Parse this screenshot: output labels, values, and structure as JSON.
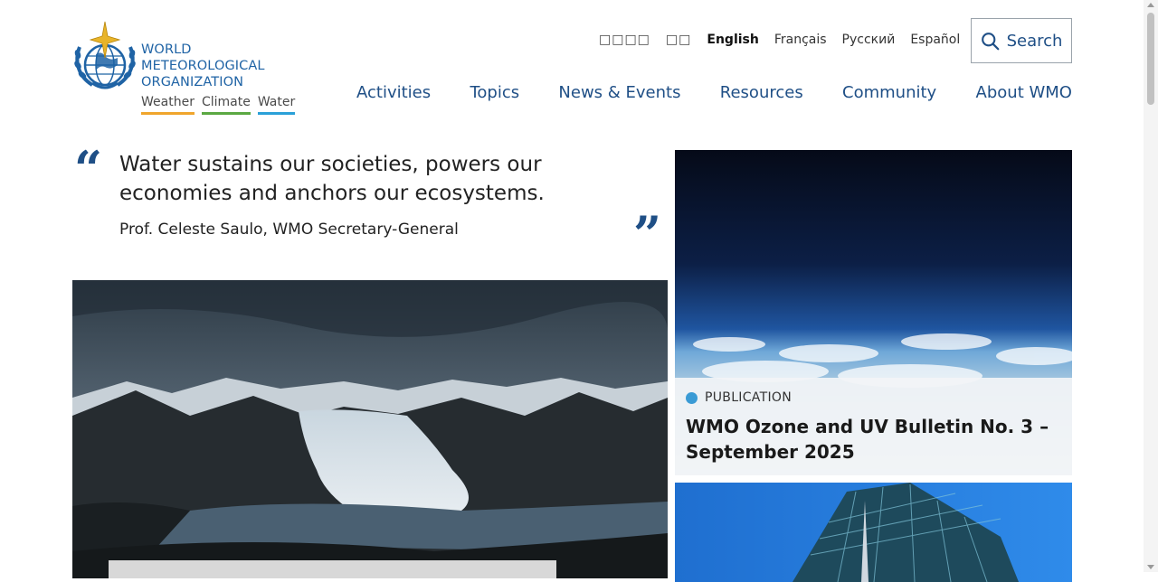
{
  "header": {
    "org_name_line1": "WORLD",
    "org_name_line2": "METEOROLOGICAL",
    "org_name_line3": "ORGANIZATION",
    "tags": [
      "Weather",
      "Climate",
      "Water"
    ],
    "emblem_icon": "wmo-emblem-icon"
  },
  "languages": [
    "□□□□",
    "□□",
    "English",
    "Français",
    "Русский",
    "Español"
  ],
  "active_language": "English",
  "search": {
    "label": "Search",
    "icon": "search-icon"
  },
  "nav": [
    "Activities",
    "Topics",
    "News & Events",
    "Resources",
    "Community",
    "About WMO"
  ],
  "quote": {
    "open_mark": "“",
    "close_mark": "”",
    "text": "Water sustains our societies, powers our economies and anchors our ecosystems.",
    "author": "Prof. Celeste Saulo, WMO Secretary-General"
  },
  "featured": {
    "category": "PUBLICATION",
    "title": "WMO Ozone and UV Bulletin No. 3 – September 2025"
  },
  "colors": {
    "brand_blue": "#1f4f86",
    "weather": "#f0a52c",
    "climate": "#5ba842",
    "water": "#2aa0d8",
    "publication_dot": "#3a9bd5"
  }
}
